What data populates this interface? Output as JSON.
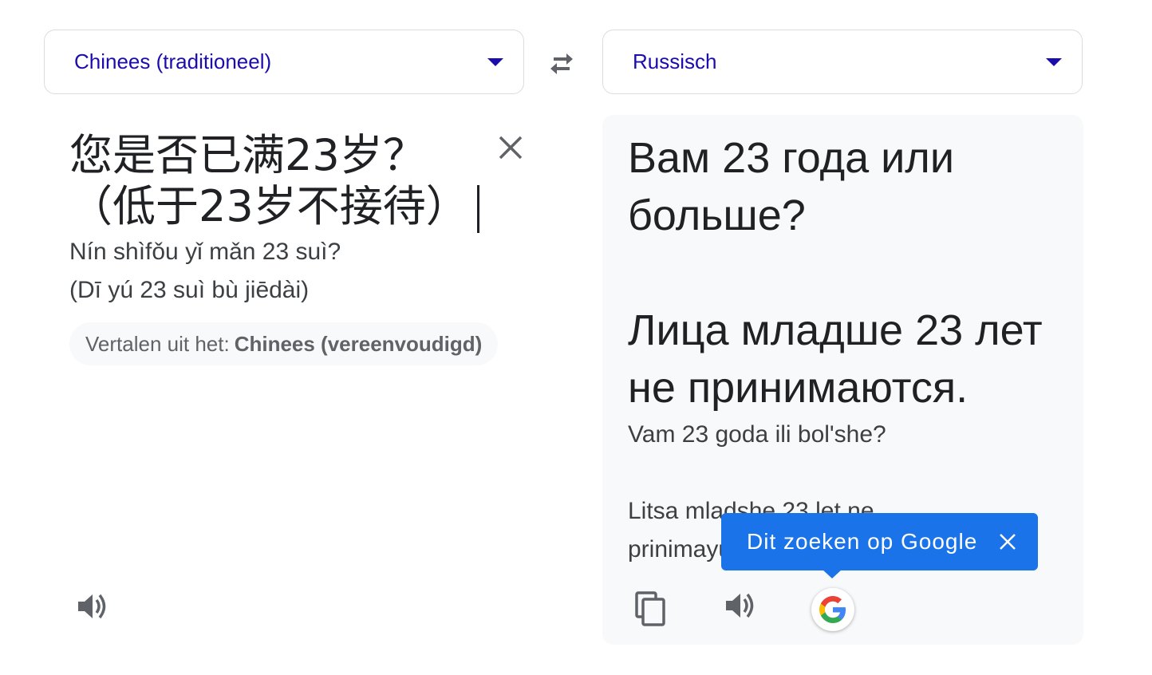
{
  "source_language": {
    "label": "Chinees (traditioneel)"
  },
  "target_language": {
    "label": "Russisch"
  },
  "source": {
    "text_line1": "您是否已满23岁？",
    "text_line2": "（低于23岁不接待）",
    "translit_line1": "Nín shìfǒu yǐ mǎn 23 suì?",
    "translit_line2": "(Dī yú 23 suì bù jiēdài)",
    "detect_prefix": "Vertalen uit het:",
    "detect_language": "Chinees (vereenvoudigd)"
  },
  "target": {
    "text_line1": "Вам 23 года или больше?",
    "text_line2": "Лица младше 23 лет не принимаются.",
    "translit_line1": "Vam 23 goda ili bol'she?",
    "translit_line2": "Litsa mladshe 23 let ne prinimayutsya."
  },
  "tooltip": {
    "label": "Dit zoeken op Google"
  },
  "icons": {
    "dropdown": "dropdown-arrow-icon",
    "swap": "swap-icon",
    "clear": "close-icon",
    "speaker": "speaker-icon",
    "copy": "copy-icon",
    "google": "google-g-icon"
  },
  "colors": {
    "language_link": "#1a0dab",
    "tooltip_bg": "#1a73e8",
    "target_panel_bg": "#f8f9fa"
  }
}
